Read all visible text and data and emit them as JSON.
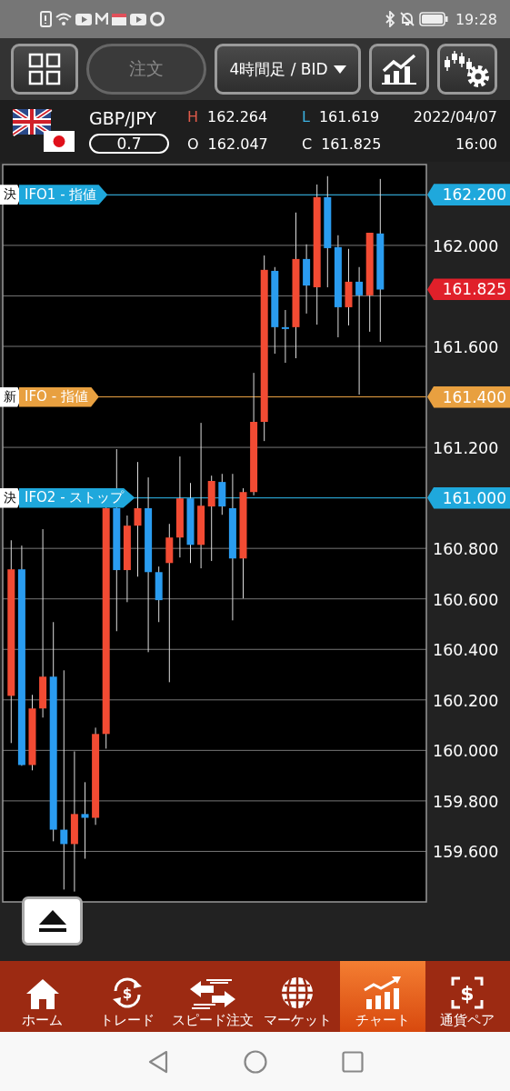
{
  "status_bar": {
    "time": "19:28"
  },
  "toolbar": {
    "order_button": {
      "label": "注文",
      "disabled": true
    },
    "timeframe": {
      "label": "4時間足 / BID"
    }
  },
  "quote": {
    "pair": "GBP/JPY",
    "spread": "0.7",
    "high_label": "H",
    "high": "162.264",
    "low_label": "L",
    "low": "161.619",
    "open_label": "O",
    "open": "162.047",
    "close_label": "C",
    "close": "161.825",
    "date": "2022/04/07",
    "time": "16:00"
  },
  "chart": {
    "order_lines": [
      {
        "badge": "決",
        "label": "IFO1 - 指値",
        "price": "162.200"
      },
      {
        "badge": "新",
        "label": "IFO - 指値",
        "price": "161.400"
      },
      {
        "badge": "決",
        "label": "IFO2 - ストップ",
        "price": "161.000"
      }
    ],
    "current_price": {
      "text": "161.825",
      "color": "#e0202a"
    },
    "chart_data": {
      "type": "candlestick",
      "categories": [
        null,
        null,
        null,
        null,
        null,
        null,
        null,
        null,
        null,
        null,
        null,
        null,
        null,
        null,
        null,
        null,
        null,
        null,
        null,
        null,
        null,
        null,
        null,
        null,
        null,
        null,
        null,
        null,
        null,
        null,
        null,
        null,
        null,
        null,
        null,
        null
      ],
      "ohlc": [
        [
          160.216,
          160.832,
          160.029,
          160.717
        ],
        [
          160.717,
          160.811,
          159.939,
          159.942
        ],
        [
          159.942,
          160.22,
          159.921,
          160.166
        ],
        [
          160.166,
          160.876,
          160.13,
          160.292
        ],
        [
          160.292,
          160.508,
          159.64,
          159.686
        ],
        [
          159.686,
          160.317,
          159.449,
          159.629
        ],
        [
          159.629,
          159.996,
          159.441,
          159.748
        ],
        [
          159.748,
          159.874,
          159.571,
          159.733
        ],
        [
          159.733,
          160.09,
          159.705,
          160.065
        ],
        [
          160.065,
          160.965,
          160.007,
          160.959
        ],
        [
          160.959,
          161.193,
          160.472,
          160.714
        ],
        [
          160.714,
          160.93,
          160.587,
          160.89
        ],
        [
          160.89,
          161.142,
          160.688,
          160.959
        ],
        [
          160.959,
          161.081,
          160.389,
          160.706
        ],
        [
          160.706,
          160.728,
          160.508,
          160.595
        ],
        [
          160.742,
          160.897,
          160.27,
          160.843
        ],
        [
          160.843,
          161.164,
          160.764,
          160.998
        ],
        [
          160.998,
          161.059,
          160.742,
          160.814
        ],
        [
          160.814,
          161.297,
          160.721,
          160.969
        ],
        [
          160.966,
          161.088,
          160.75,
          161.067
        ],
        [
          161.063,
          161.095,
          160.933,
          160.966
        ],
        [
          160.959,
          161.095,
          160.515,
          160.76
        ],
        [
          160.76,
          161.038,
          160.602,
          161.023
        ],
        [
          161.023,
          161.495,
          161.01,
          161.301
        ],
        [
          161.301,
          161.96,
          161.225,
          161.903
        ],
        [
          161.899,
          161.914,
          161.571,
          161.676
        ],
        [
          161.676,
          161.744,
          161.535,
          161.672
        ],
        [
          161.676,
          162.13,
          161.553,
          161.946
        ],
        [
          161.946,
          162.004,
          161.73,
          161.841
        ],
        [
          161.834,
          162.241,
          161.686,
          162.191
        ],
        [
          162.191,
          162.274,
          161.834,
          161.989
        ],
        [
          161.993,
          162.04,
          161.636,
          161.755
        ],
        [
          161.755,
          161.986,
          161.683,
          161.856
        ],
        [
          161.856,
          161.914,
          161.409,
          161.802
        ],
        [
          161.802,
          162.05,
          161.658,
          162.05
        ],
        [
          162.047,
          162.263,
          161.618,
          161.825
        ]
      ],
      "grid": true,
      "ylim": [
        159.4,
        162.32
      ],
      "yticks": [
        {
          "value": 159.6,
          "label": "159.600"
        },
        {
          "value": 159.8,
          "label": "159.800"
        },
        {
          "value": 160.0,
          "label": "160.000"
        },
        {
          "value": 160.2,
          "label": "160.200"
        },
        {
          "value": 160.4,
          "label": "160.400"
        },
        {
          "value": 160.6,
          "label": "160.600"
        },
        {
          "value": 160.8,
          "label": "160.800"
        },
        {
          "value": 161.2,
          "label": "161.200"
        },
        {
          "value": 161.6,
          "label": "161.600"
        },
        {
          "value": 162.0,
          "label": "162.000"
        }
      ],
      "ref_lines": [
        {
          "axis": "y",
          "value": 162.2,
          "color": "#1fa8dc"
        },
        {
          "axis": "y",
          "value": 161.4,
          "color": "#e8a040"
        },
        {
          "axis": "y",
          "value": 161.0,
          "color": "#1fa8dc"
        }
      ]
    }
  },
  "bottom_nav": [
    {
      "label": "ホーム",
      "selected": false
    },
    {
      "label": "トレード",
      "symbol": "$",
      "selected": false
    },
    {
      "label": "スピード注文",
      "selected": false
    },
    {
      "label": "マーケット",
      "selected": false
    },
    {
      "label": "チャート",
      "selected": true
    },
    {
      "label": "通貨ペア",
      "symbol": "$",
      "selected": false
    }
  ]
}
